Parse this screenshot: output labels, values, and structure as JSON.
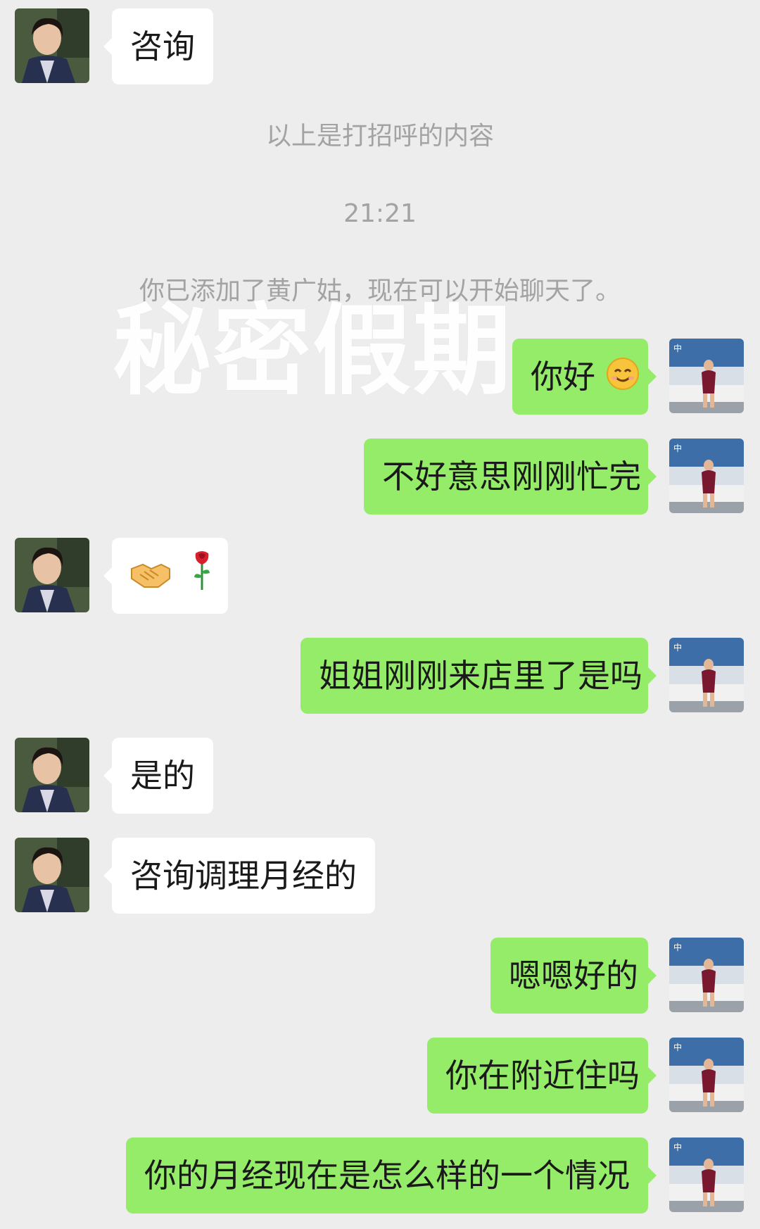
{
  "system": {
    "greeting_note": "以上是打招呼的内容",
    "timestamp": "21:21",
    "added_note": "你已添加了黄广姑，现在可以开始聊天了。"
  },
  "watermark": "秘密假期",
  "messages": [
    {
      "side": "left",
      "text": "咨询"
    },
    {
      "side": "right",
      "text": "你好",
      "emoji": "smiling-face-icon"
    },
    {
      "side": "right",
      "text": "不好意思刚刚忙完"
    },
    {
      "side": "left",
      "emoji": [
        "handshake-icon",
        "rose-icon"
      ]
    },
    {
      "side": "right",
      "text": "姐姐刚刚来店里了是吗"
    },
    {
      "side": "left",
      "text": "是的"
    },
    {
      "side": "left",
      "text": "咨询调理月经的"
    },
    {
      "side": "right",
      "text": "嗯嗯好的"
    },
    {
      "side": "right",
      "text": "你在附近住吗"
    },
    {
      "side": "right",
      "text": "你的月经现在是怎么样的一个情况"
    }
  ],
  "colors": {
    "background": "#ededed",
    "sent_bubble": "#95ec69",
    "received_bubble": "#ffffff",
    "system_text": "#a3a3a3"
  }
}
